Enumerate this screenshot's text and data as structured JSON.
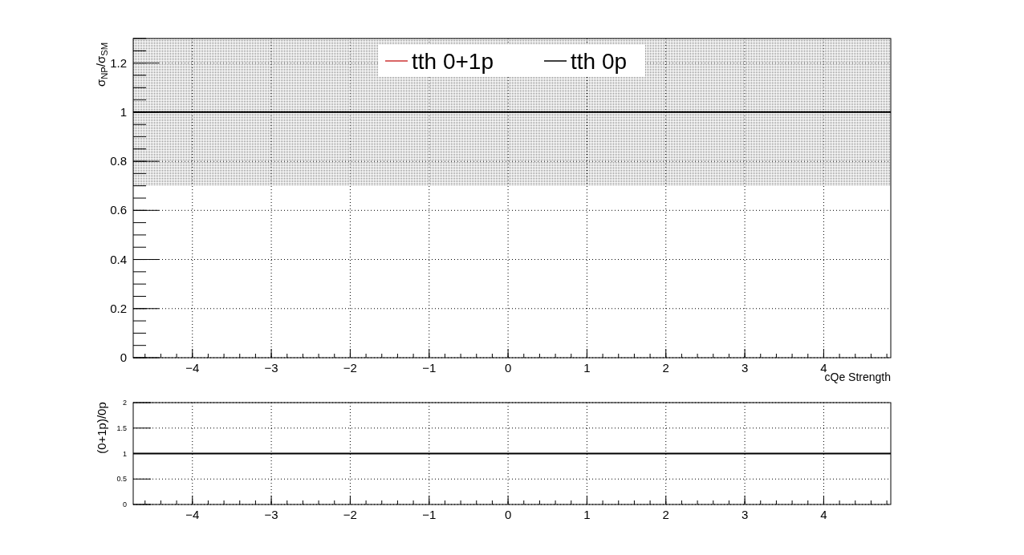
{
  "top_plot": {
    "chart_data": {
      "type": "line",
      "xlabel": "cQe Strength",
      "ylabel": "σ$_{NP}$/σ$_{SM}$",
      "x": [
        -4.75,
        4.85
      ],
      "legend": "top",
      "series": [
        {
          "name": "tth 0+1p",
          "color": "#cc3333",
          "line_style": "solid",
          "values": [
            null,
            null
          ]
        },
        {
          "name": "tth 0p",
          "color": "#000000",
          "line_style": "solid",
          "values": [
            1,
            1
          ]
        }
      ],
      "xlim": [
        -4.75,
        4.85
      ],
      "ylim": [
        0,
        1.3
      ],
      "xticks": [
        {
          "value": -4,
          "label": "−4"
        },
        {
          "value": -3,
          "label": "−3"
        },
        {
          "value": -2,
          "label": "−2"
        },
        {
          "value": -1,
          "label": "−1"
        },
        {
          "value": 0,
          "label": "0"
        },
        {
          "value": 1,
          "label": "1"
        },
        {
          "value": 2,
          "label": "2"
        },
        {
          "value": 3,
          "label": "3"
        },
        {
          "value": 4,
          "label": "4"
        }
      ],
      "yticks": [
        {
          "value": 0,
          "label": "0"
        },
        {
          "value": 0.2,
          "label": "0.2"
        },
        {
          "value": 0.4,
          "label": "0.4"
        },
        {
          "value": 0.6,
          "label": "0.6"
        },
        {
          "value": 0.8,
          "label": "0.8"
        },
        {
          "value": 1,
          "label": "1"
        },
        {
          "value": 1.2,
          "label": "1.2"
        }
      ],
      "bands": [
        {
          "axis": "y",
          "from": 0.7,
          "to": 1.3
        }
      ]
    }
  },
  "bottom_plot": {
    "chart_data": {
      "type": "line",
      "ylabel": "(0+1p)/0p",
      "x": [
        -4.75,
        4.85
      ],
      "series": [
        {
          "color": "#000000",
          "line_style": "solid",
          "values": [
            1,
            1
          ]
        }
      ],
      "xlim": [
        -4.75,
        4.85
      ],
      "ylim": [
        0,
        2
      ],
      "xticks": [
        {
          "value": -4,
          "label": "−4"
        },
        {
          "value": -3,
          "label": "−3"
        },
        {
          "value": -2,
          "label": "−2"
        },
        {
          "value": -1,
          "label": "−1"
        },
        {
          "value": 0,
          "label": "0"
        },
        {
          "value": 1,
          "label": "1"
        },
        {
          "value": 2,
          "label": "2"
        },
        {
          "value": 3,
          "label": "3"
        },
        {
          "value": 4,
          "label": "4"
        }
      ],
      "yticks": [
        {
          "value": 0,
          "label": "0"
        },
        {
          "value": 0.5,
          "label": "0.5"
        },
        {
          "value": 1,
          "label": "1"
        },
        {
          "value": 1.5,
          "label": "1.5"
        },
        {
          "value": 2,
          "label": "2"
        }
      ]
    }
  }
}
